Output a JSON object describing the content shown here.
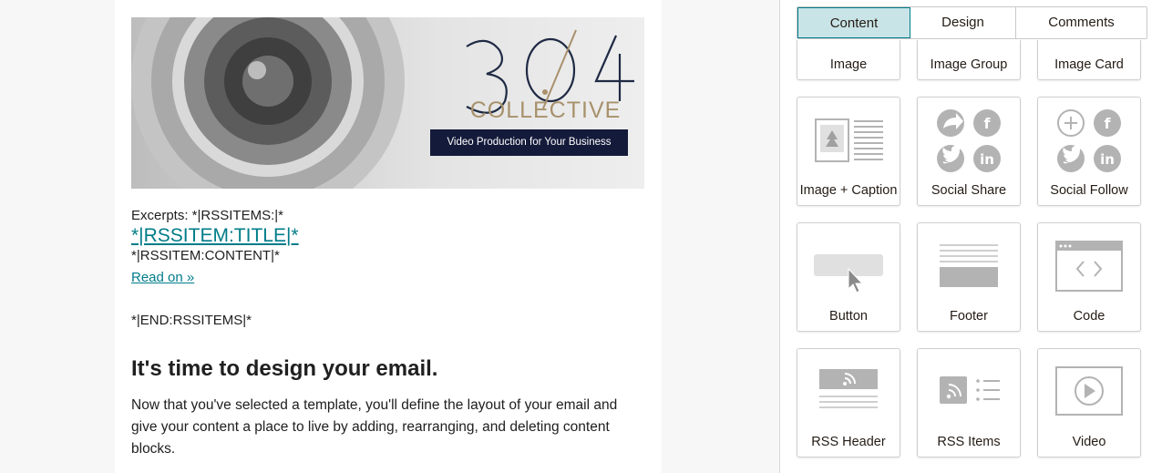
{
  "email": {
    "banner": {
      "brand_number": "304",
      "brand_name": "COLLECTIVE",
      "tagline": "Video Production for Your Business"
    },
    "excerpt": {
      "label": "Excerpts: *|RSSITEMS:|*",
      "title": "*|RSSITEM:TITLE|*",
      "content": "*|RSSITEM:CONTENT|*",
      "read_more": "Read on »",
      "end_tag": "*|END:RSSITEMS|*"
    },
    "heading": "It's time to design your email.",
    "body": "Now that you've selected a template, you'll define the layout of your email and give your content a place to live by adding, rearranging, and deleting content blocks."
  },
  "panel": {
    "tabs": [
      {
        "label": "Content",
        "active": true
      },
      {
        "label": "Design",
        "active": false
      },
      {
        "label": "Comments",
        "active": false
      }
    ],
    "blocks": [
      {
        "label": "Image",
        "icon": "image-icon"
      },
      {
        "label": "Image Group",
        "icon": "image-group-icon"
      },
      {
        "label": "Image Card",
        "icon": "image-card-icon"
      },
      {
        "label": "Image + Caption",
        "icon": "image-caption-icon"
      },
      {
        "label": "Social Share",
        "icon": "social-share-icon"
      },
      {
        "label": "Social Follow",
        "icon": "social-follow-icon"
      },
      {
        "label": "Button",
        "icon": "button-icon"
      },
      {
        "label": "Footer",
        "icon": "footer-icon"
      },
      {
        "label": "Code",
        "icon": "code-icon"
      },
      {
        "label": "RSS Header",
        "icon": "rss-header-icon"
      },
      {
        "label": "RSS Items",
        "icon": "rss-items-icon"
      },
      {
        "label": "Video",
        "icon": "video-icon"
      }
    ]
  },
  "colors": {
    "accent": "#007c89",
    "tab_active_bg": "#c9e4e7",
    "brand_dark": "#141a3a",
    "brand_gold": "#a8916c",
    "icon_gray": "#b3b3b3"
  }
}
